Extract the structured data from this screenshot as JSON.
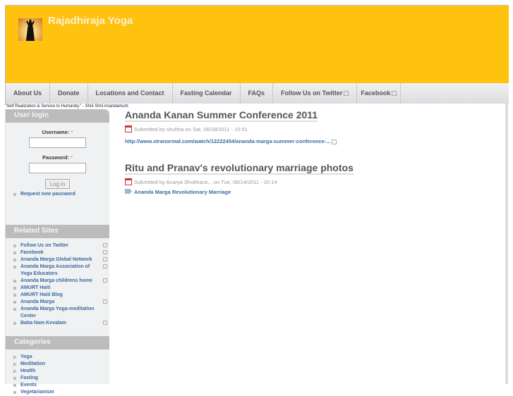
{
  "site": {
    "name": "Rajadhiraja Yoga",
    "slogan": "\"Self Realization & Service to Humanity.\" - Shrii Shrii Anandamurti"
  },
  "nav": [
    {
      "label": "About Us"
    },
    {
      "label": "Donate"
    },
    {
      "label": "Locations and Contact"
    },
    {
      "label": "Fasting Calendar"
    },
    {
      "label": "FAQs"
    },
    {
      "label": "Follow Us on Twitter",
      "external": true
    },
    {
      "label": "Facebook",
      "external": true
    }
  ],
  "login": {
    "title": "User login",
    "username_label": "Username:",
    "password_label": "Password:",
    "required": "*",
    "username_value": "",
    "password_value": "",
    "button": "Log in",
    "request_password": "Request new password"
  },
  "related": {
    "title": "Related Sites",
    "items": [
      {
        "label": "Follow Us on Twitter"
      },
      {
        "label": "Facebook"
      },
      {
        "label": "Ananda Marga Global Network"
      },
      {
        "label": "Ananda Marga Association of Yoga Educators"
      },
      {
        "label": "Ananda Marga childrens home"
      },
      {
        "label": "AMURT Haiti"
      },
      {
        "label": "AMURT Haiti Blog"
      },
      {
        "label": "Ananda Marga"
      },
      {
        "label": "Ananda Marga Yoga-meditation Center"
      },
      {
        "label": "Baba Nam Kevalam"
      }
    ]
  },
  "categories": {
    "title": "Categories",
    "items": [
      {
        "label": "Yoga"
      },
      {
        "label": "Meditation"
      },
      {
        "label": "Health"
      },
      {
        "label": "Fasting"
      },
      {
        "label": "Events"
      },
      {
        "label": "Vegetarianism"
      }
    ]
  },
  "posts": [
    {
      "title": "Ananda Kanan Summer Conference 2011",
      "meta": "Submitted by shubha on Sat, 06/18/2011 - 15:51",
      "link": "http://www.xtranormal.com/watch/12222454/ananda-marga-summer-conference-..."
    },
    {
      "title": "Ritu and Pranav's revolutionary marriage photos",
      "meta": "Submitted by Acarya Shubhace... on Tue, 06/14/2011 - 20:14",
      "tag": "Ananda Marga Revolutionary Marriage"
    }
  ]
}
